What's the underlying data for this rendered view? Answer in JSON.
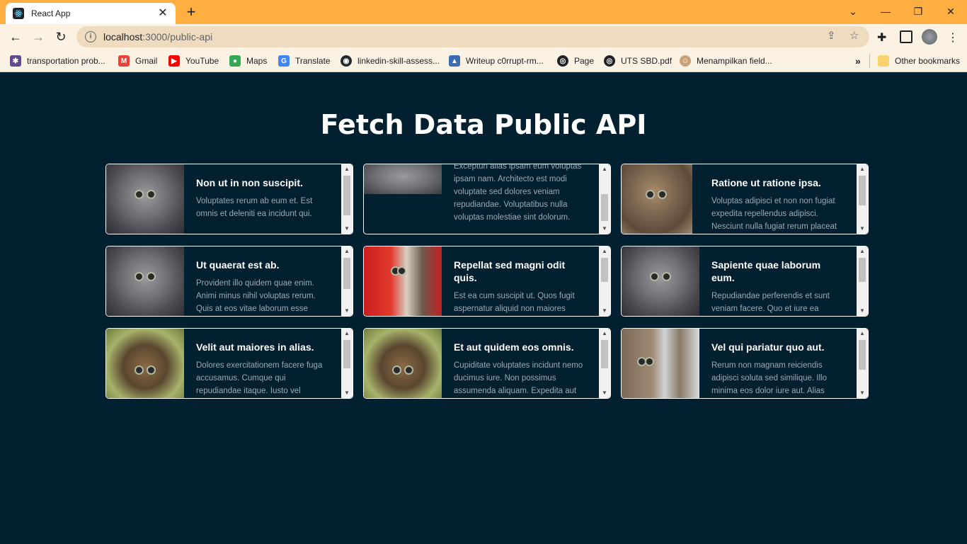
{
  "browser": {
    "tab_title": "React App",
    "new_tab_icon": "+",
    "url_host": "localhost",
    "url_rest": ":3000/public-api",
    "bookmarks": [
      {
        "label": "transportation prob...",
        "icon": "settings-icon",
        "color": "#5f4b8b"
      },
      {
        "label": "Gmail",
        "icon": "gmail-icon",
        "color": "#ea4335"
      },
      {
        "label": "YouTube",
        "icon": "youtube-icon",
        "color": "#ff0000"
      },
      {
        "label": "Maps",
        "icon": "maps-icon",
        "color": "#34a853"
      },
      {
        "label": "Translate",
        "icon": "translate-icon",
        "color": "#4285f4"
      },
      {
        "label": "linkedin-skill-assess...",
        "icon": "github-icon",
        "color": "#24292e"
      },
      {
        "label": "Writeup c0rrupt-rm...",
        "icon": "image-icon",
        "color": "#3b6db3"
      },
      {
        "label": "Page",
        "icon": "globe-icon",
        "color": "#202124"
      },
      {
        "label": "UTS SBD.pdf",
        "icon": "globe-icon",
        "color": "#202124"
      },
      {
        "label": "Menampilkan field...",
        "icon": "avatar-icon",
        "color": "#c9a27a"
      }
    ],
    "overflow": "»",
    "other_bookmarks": "Other bookmarks"
  },
  "page": {
    "title": "Fetch Data Public API"
  },
  "cards": [
    {
      "title": "Non ut in non suscipit.",
      "text": "Voluptates rerum ab eum et. Est omnis et deleniti ea incidunt qui."
    },
    {
      "title": "",
      "text": "Excepturi alias ipsam eum voluptas ipsam nam. Architecto est modi voluptate sed dolores veniam repudiandae. Voluptatibus nulla voluptas molestiae sint dolorum."
    },
    {
      "title": "Ratione ut ratione ipsa.",
      "text": "Voluptas adipisci et non non fugiat expedita repellendus adipisci. Nesciunt nulla fugiat rerum placeat"
    },
    {
      "title": "Ut quaerat est ab.",
      "text": "Provident illo quidem quae enim. Animi minus nihil voluptas rerum. Quis at eos vitae laborum esse"
    },
    {
      "title": "Repellat sed magni odit quis.",
      "text": "Est ea cum suscipit ut. Quos fugit aspernatur aliquid non maiores"
    },
    {
      "title": "Sapiente quae laborum eum.",
      "text": "Repudiandae perferendis et sunt veniam facere. Quo et iure ea"
    },
    {
      "title": "Velit aut maiores in alias.",
      "text": "Dolores exercitationem facere fuga accusamus. Cumque qui repudiandae itaque. Iusto vel"
    },
    {
      "title": "Et aut quidem eos omnis.",
      "text": "Cupiditate voluptates incidunt nemo ducimus iure. Non possimus assumenda aliquam. Expedita aut"
    },
    {
      "title": "Vel qui pariatur quo aut.",
      "text": "Rerum non magnam reiciendis adipisci soluta sed similique. Illo minima eos dolor iure aut. Alias"
    }
  ]
}
